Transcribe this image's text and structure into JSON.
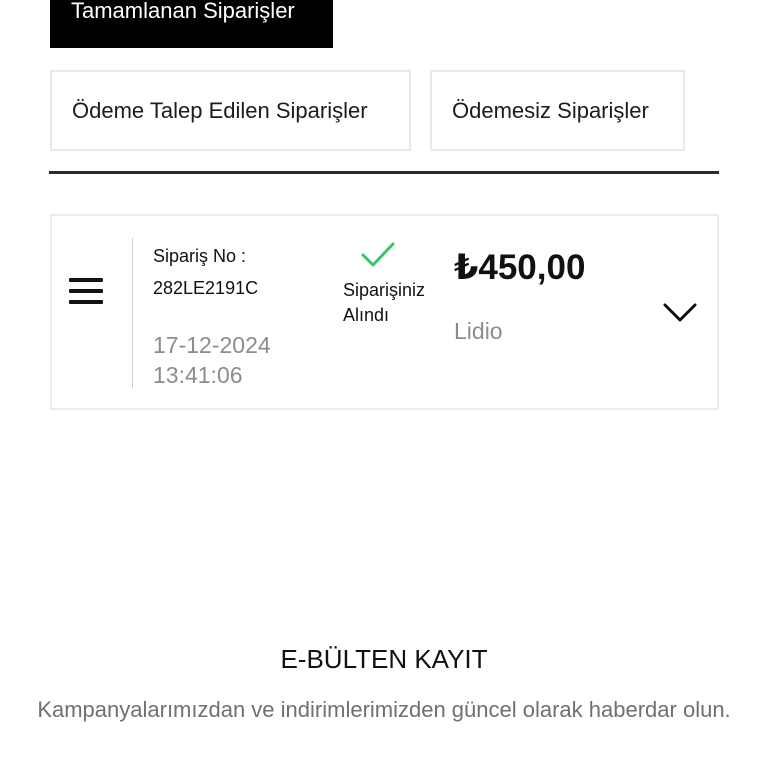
{
  "tabs": {
    "completed": "Tamamlanan Siparişler",
    "payment_requested": "Ödeme Talep Edilen Siparişler",
    "unpaid": "Ödemesiz Siparişler"
  },
  "order": {
    "order_no_label": "Sipariş No :",
    "order_no": "282LE2191C",
    "date": "17-12-2024",
    "time": "13:41:06",
    "status_line1": "Siparişiniz",
    "status_line2": "Alındı",
    "price": "₺450,00",
    "brand": "Lidio",
    "icons": {
      "menu": "menu-icon",
      "status": "check-icon",
      "expand": "chevron-down-icon"
    }
  },
  "newsletter": {
    "title": "E-BÜLTEN KAYIT",
    "description": "Kampanyalarımızdan ve indirimlerimizden güncel olarak haberdar olun."
  },
  "colors": {
    "check": "#3dc46a",
    "muted_text": "#8c8c8c",
    "divider": "#2a2a2a"
  }
}
